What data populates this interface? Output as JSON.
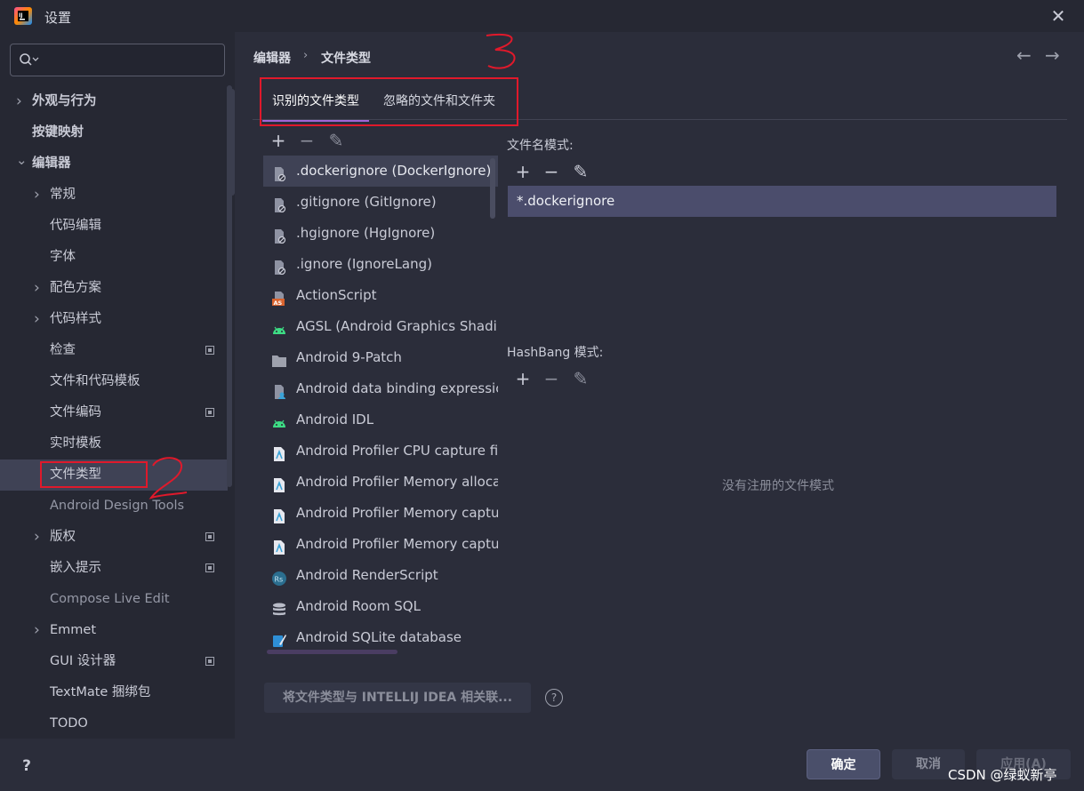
{
  "window": {
    "title": "设置"
  },
  "sidebar": {
    "search": {
      "placeholder": "",
      "value": ""
    },
    "items": [
      {
        "label": "外观与行为",
        "expandable": true,
        "expanded": false,
        "bold": true
      },
      {
        "label": "按键映射",
        "bold": true
      },
      {
        "label": "编辑器",
        "expandable": true,
        "expanded": true,
        "bold": true
      },
      {
        "label": "常规",
        "expandable": true,
        "expanded": false
      },
      {
        "label": "代码编辑"
      },
      {
        "label": "字体"
      },
      {
        "label": "配色方案",
        "expandable": true,
        "expanded": false
      },
      {
        "label": "代码样式",
        "expandable": true,
        "expanded": false
      },
      {
        "label": "检查",
        "badge": true
      },
      {
        "label": "文件和代码模板"
      },
      {
        "label": "文件编码",
        "badge": true
      },
      {
        "label": "实时模板"
      },
      {
        "label": "文件类型",
        "selected": true
      },
      {
        "label": "Android Design Tools",
        "dim": true
      },
      {
        "label": "版权",
        "expandable": true,
        "expanded": false,
        "badge": true
      },
      {
        "label": "嵌入提示",
        "badge": true
      },
      {
        "label": "Compose Live Edit",
        "dim": true
      },
      {
        "label": "Emmet",
        "expandable": true,
        "expanded": false
      },
      {
        "label": "GUI 设计器",
        "badge": true
      },
      {
        "label": "TextMate 捆绑包"
      },
      {
        "label": "TODO"
      }
    ],
    "annotation": "2"
  },
  "breadcrumb": {
    "parent": "编辑器",
    "separator": "›",
    "current": "文件类型"
  },
  "annotation_top": "3",
  "tabs": [
    {
      "label": "识别的文件类型",
      "active": true
    },
    {
      "label": "忽略的文件和文件夹",
      "active": false
    }
  ],
  "toolbar": {
    "add": "+",
    "remove": "−",
    "edit": "✎"
  },
  "file_types": [
    {
      "label": ".dockerignore (DockerIgnore)",
      "icon": "ignore-file-icon",
      "selected": true
    },
    {
      "label": ".gitignore (GitIgnore)",
      "icon": "ignore-file-icon"
    },
    {
      "label": ".hgignore (HgIgnore)",
      "icon": "ignore-file-icon"
    },
    {
      "label": ".ignore (IgnoreLang)",
      "icon": "ignore-file-icon"
    },
    {
      "label": "ActionScript",
      "icon": "actionscript-icon"
    },
    {
      "label": "AGSL (Android Graphics Shadin",
      "icon": "android-icon"
    },
    {
      "label": "Android 9-Patch",
      "icon": "folder-icon"
    },
    {
      "label": "Android data binding expressic",
      "icon": "databinding-icon"
    },
    {
      "label": "Android IDL",
      "icon": "android-icon"
    },
    {
      "label": "Android Profiler CPU capture fil",
      "icon": "profiler-file-icon"
    },
    {
      "label": "Android Profiler Memory alloca",
      "icon": "profiler-file-icon"
    },
    {
      "label": "Android Profiler Memory captu",
      "icon": "profiler-file-icon"
    },
    {
      "label": "Android Profiler Memory captu",
      "icon": "profiler-file-icon"
    },
    {
      "label": "Android RenderScript",
      "icon": "renderscript-icon"
    },
    {
      "label": "Android Room SQL",
      "icon": "database-icon"
    },
    {
      "label": "Android SQLite database",
      "icon": "sqlite-icon"
    }
  ],
  "patterns": {
    "label": "文件名模式:",
    "items": [
      "*.dockerignore"
    ]
  },
  "hashbang": {
    "label": "HashBang 模式:",
    "empty_text": "没有注册的文件模式"
  },
  "associate_button": "将文件类型与 INTELLIJ IDEA 相关联...",
  "assoc_help": "?",
  "help_button": "?",
  "buttons": {
    "ok": "确定",
    "cancel": "取消",
    "apply": "应用(A)"
  },
  "watermark": "CSDN @绿蚁新亭",
  "colors": {
    "accent": "#a166d6",
    "selection": "#4b4d6c",
    "annotation_red": "#e0192b"
  }
}
